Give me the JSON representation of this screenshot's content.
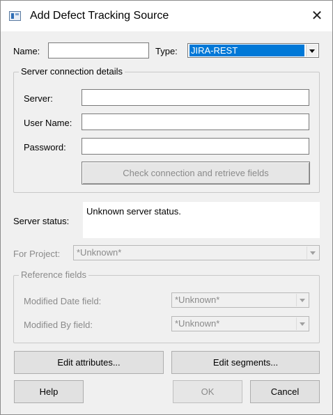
{
  "window": {
    "title": "Add Defect Tracking Source",
    "close_glyph": "✕"
  },
  "form": {
    "name_label": "Name:",
    "name_value": "",
    "type_label": "Type:",
    "type_value": "JIRA-REST"
  },
  "server_group": {
    "legend": "Server connection details",
    "server_label": "Server:",
    "server_value": "",
    "username_label": "User Name:",
    "username_value": "",
    "password_label": "Password:",
    "password_value": "",
    "check_button": "Check connection and retrieve fields"
  },
  "status": {
    "label": "Server status:",
    "text": "Unknown server status."
  },
  "project": {
    "label": "For Project:",
    "value": "*Unknown*"
  },
  "reference_group": {
    "legend": "Reference fields",
    "modified_date_label": "Modified Date field:",
    "modified_date_value": "*Unknown*",
    "modified_by_label": "Modified By field:",
    "modified_by_value": "*Unknown*"
  },
  "buttons": {
    "edit_attributes": "Edit attributes...",
    "edit_segments": "Edit segments...",
    "help": "Help",
    "ok": "OK",
    "cancel": "Cancel"
  }
}
